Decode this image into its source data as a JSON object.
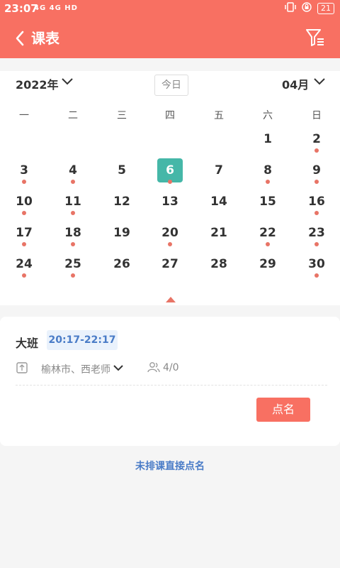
{
  "status_bar": {
    "time": "23:07",
    "signal_text": "4G 4G HD",
    "battery": "21"
  },
  "app_bar": {
    "title": "课表",
    "icons": [
      "back-arrow-icon",
      "filter-icon"
    ]
  },
  "calendar": {
    "year": "2022年",
    "today_button": "今日",
    "month": "04月",
    "weekdays": [
      "一",
      "二",
      "三",
      "四",
      "五",
      "六",
      "日"
    ],
    "days": [
      {
        "num": "1",
        "dot": false
      },
      {
        "num": "2",
        "dot": true
      },
      {
        "num": "3",
        "dot": true
      },
      {
        "num": "4",
        "dot": true
      },
      {
        "num": "5",
        "dot": false
      },
      {
        "num": "6",
        "dot": true,
        "selected": true
      },
      {
        "num": "7",
        "dot": false
      },
      {
        "num": "8",
        "dot": true
      },
      {
        "num": "9",
        "dot": true
      },
      {
        "num": "10",
        "dot": true
      },
      {
        "num": "11",
        "dot": true
      },
      {
        "num": "12",
        "dot": false
      },
      {
        "num": "13",
        "dot": false
      },
      {
        "num": "14",
        "dot": false
      },
      {
        "num": "15",
        "dot": false
      },
      {
        "num": "16",
        "dot": true
      },
      {
        "num": "17",
        "dot": true
      },
      {
        "num": "18",
        "dot": true
      },
      {
        "num": "19",
        "dot": false
      },
      {
        "num": "20",
        "dot": true
      },
      {
        "num": "21",
        "dot": false
      },
      {
        "num": "22",
        "dot": true
      },
      {
        "num": "23",
        "dot": true
      },
      {
        "num": "24",
        "dot": true
      },
      {
        "num": "25",
        "dot": true
      },
      {
        "num": "26",
        "dot": false
      },
      {
        "num": "27",
        "dot": false
      },
      {
        "num": "28",
        "dot": false
      },
      {
        "num": "29",
        "dot": false
      },
      {
        "num": "30",
        "dot": true
      }
    ],
    "first_day_column": 5,
    "dot_color": "#e87466",
    "selected_color": "#45b7a8"
  },
  "class_card": {
    "class_name": "大班",
    "time_range": "20:17-22:17",
    "location_teacher": "榆林市、西老师",
    "attendance": "4/0",
    "rollcall_button": "点名"
  },
  "direct_rollcall_link": "未排课直接点名",
  "colors": {
    "brand": "#f87062",
    "link": "#4a7cc7"
  }
}
